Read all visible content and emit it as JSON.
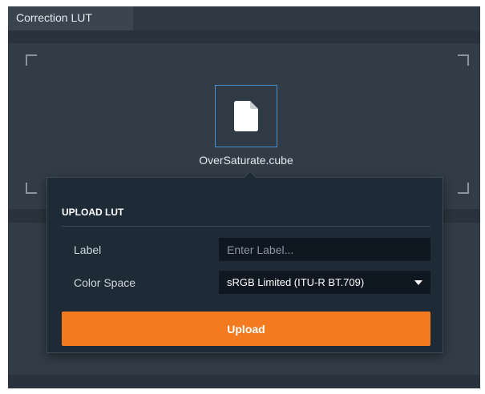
{
  "tabs": {
    "active_label": "Correction LUT"
  },
  "file": {
    "name": "OverSaturate.cube",
    "icon": "file-icon"
  },
  "upload_panel": {
    "title": "UPLOAD LUT",
    "label_field": {
      "label": "Label",
      "value": "",
      "placeholder": "Enter Label..."
    },
    "color_space_field": {
      "label": "Color Space",
      "selected": "sRGB Limited (ITU-R BT.709)"
    },
    "upload_button_label": "Upload"
  },
  "colors": {
    "accent": "#f47a20",
    "selection_border": "#4a8fd0",
    "panel_bg": "#1f2a37"
  }
}
